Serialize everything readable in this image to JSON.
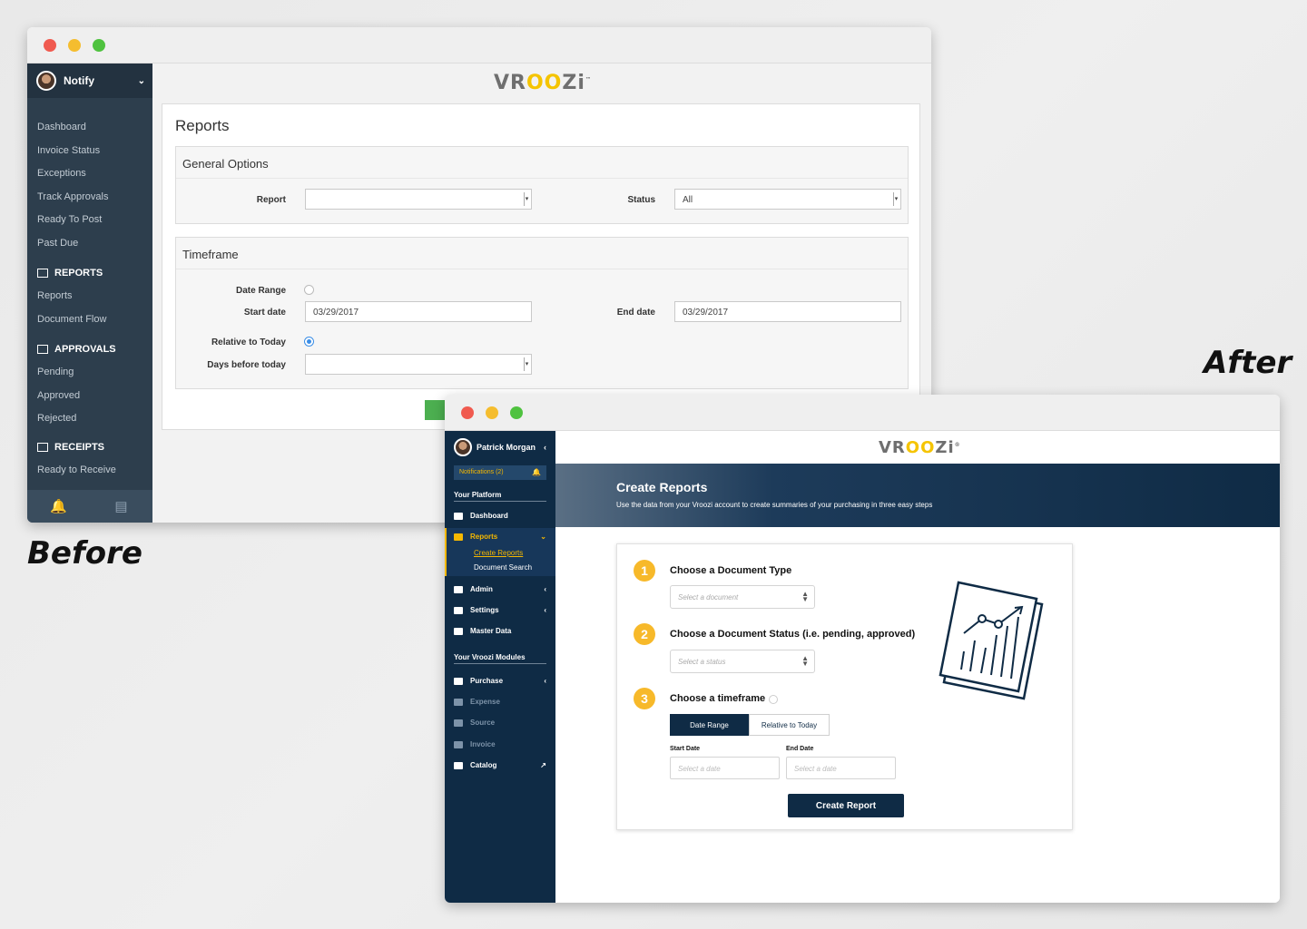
{
  "captions": {
    "before": "Before",
    "after": "After"
  },
  "before": {
    "user": {
      "name": "Notify",
      "chevron": "⌄"
    },
    "logo": {
      "pre": "VR",
      "oo": "OO",
      "post": "Zi",
      "tm": "™"
    },
    "nav": [
      "Dashboard",
      "Invoice Status",
      "Exceptions",
      "Track Approvals",
      "Ready To Post",
      "Past Due"
    ],
    "sections": [
      {
        "label": "REPORTS",
        "icon": "bar-chart-icon",
        "items": [
          "Reports",
          "Document Flow"
        ]
      },
      {
        "label": "APPROVALS",
        "icon": "list-icon",
        "items": [
          "Pending",
          "Approved",
          "Rejected"
        ]
      },
      {
        "label": "RECEIPTS",
        "icon": "receipt-icon",
        "items": [
          "Ready to Receive"
        ]
      }
    ],
    "bottom_icons": [
      "bell-icon",
      "book-icon"
    ],
    "page_title": "Reports",
    "general": {
      "legend": "General Options",
      "report_label": "Report",
      "report_value": "",
      "status_label": "Status",
      "status_value": "All"
    },
    "timeframe": {
      "legend": "Timeframe",
      "date_range_label": "Date Range",
      "start_label": "Start date",
      "start_value": "03/29/2017",
      "end_label": "End date",
      "end_value": "03/29/2017",
      "relative_label": "Relative to Today",
      "days_label": "Days before today",
      "days_value": ""
    },
    "accent_color": "#4caf50"
  },
  "after": {
    "user": {
      "name": "Patrick Morgan",
      "chevron": "‹"
    },
    "notifications": "Notifications (2)",
    "logo": {
      "pre": "VR",
      "oo": "OO",
      "post": "Zi",
      "tm": "®"
    },
    "platform_heading": "Your Platform",
    "platform_items": [
      {
        "label": "Dashboard",
        "icon": "monitor-icon"
      },
      {
        "label": "Reports",
        "icon": "bar-chart-icon",
        "active": true
      },
      {
        "label": "Admin",
        "icon": "users-icon"
      },
      {
        "label": "Settings",
        "icon": "gear-icon"
      },
      {
        "label": "Master Data",
        "icon": "database-icon"
      }
    ],
    "reports_sub": [
      "Create Reports",
      "Document Search"
    ],
    "modules_heading": "Your Vroozi Modules",
    "module_items": [
      {
        "label": "Purchase",
        "icon": "cart-icon"
      },
      {
        "label": "Expense",
        "icon": "card-icon"
      },
      {
        "label": "Source",
        "icon": "pin-icon"
      },
      {
        "label": "Invoice",
        "icon": "invoice-icon"
      },
      {
        "label": "Catalog",
        "icon": "book-icon"
      }
    ],
    "hero": {
      "title": "Create Reports",
      "subtitle": "Use the data from your Vroozi account to create summaries of your purchasing in three easy steps"
    },
    "steps": [
      {
        "num": "1",
        "title": "Choose a Document Type",
        "placeholder": "Select a document"
      },
      {
        "num": "2",
        "title": "Choose a Document Status (i.e. pending, approved)",
        "placeholder": "Select a status"
      },
      {
        "num": "3",
        "title": "Choose a timeframe"
      }
    ],
    "toggle": {
      "date_range": "Date Range",
      "relative": "Relative to Today"
    },
    "start_label": "Start Date",
    "end_label": "End Date",
    "date_placeholder": "Select a date",
    "create_button": "Create Report",
    "colors": {
      "navy": "#0f2b45",
      "gold": "#f5b800",
      "step": "#f7b92a"
    }
  }
}
